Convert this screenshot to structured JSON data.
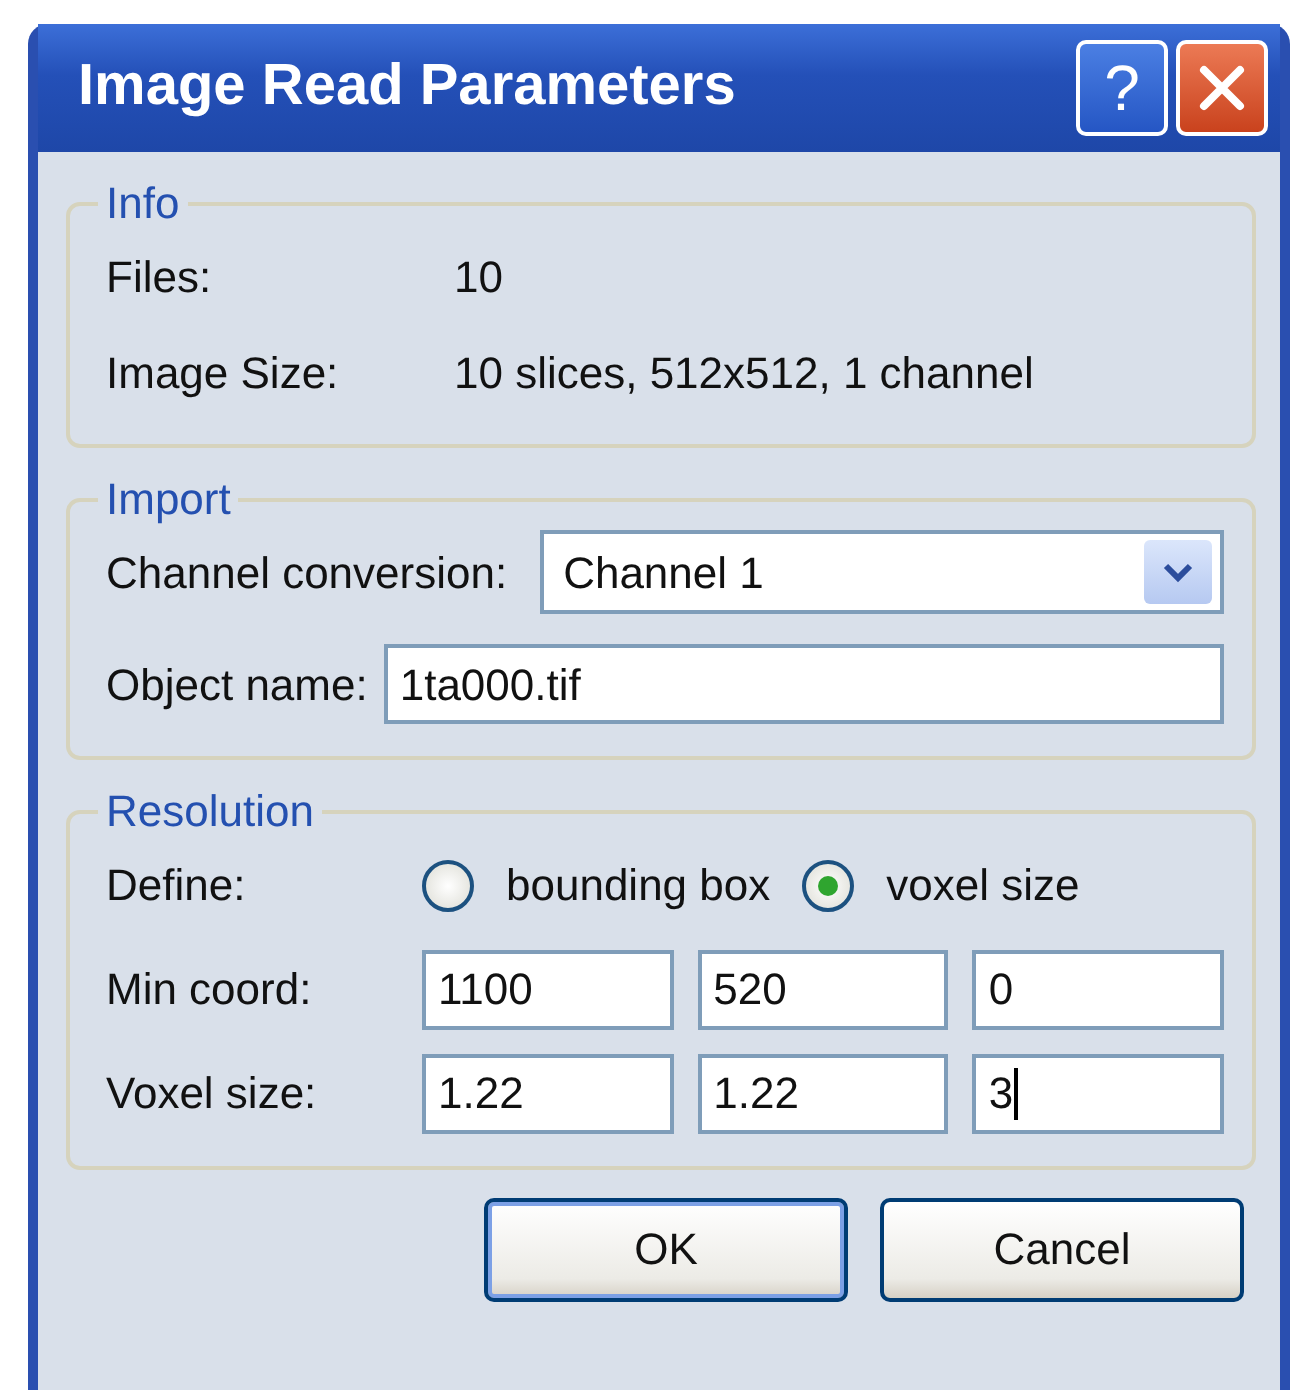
{
  "window": {
    "title": "Image Read Parameters",
    "help_label": "?"
  },
  "info": {
    "title": "Info",
    "rows": [
      {
        "label": "Files:",
        "value": "10"
      },
      {
        "label": "Image Size:",
        "value": "10 slices, 512x512, 1 channel"
      }
    ]
  },
  "import": {
    "title": "Import",
    "channel_conversion": {
      "label": "Channel conversion:",
      "value": "Channel 1"
    },
    "object_name": {
      "label": "Object name:",
      "value": "1ta000.tif"
    }
  },
  "resolution": {
    "title": "Resolution",
    "define": {
      "label": "Define:",
      "options": [
        {
          "label": "bounding box",
          "selected": false
        },
        {
          "label": "voxel size",
          "selected": true
        }
      ]
    },
    "rows": [
      {
        "label": "Min coord:",
        "fields": [
          {
            "value": "1100",
            "focused": false
          },
          {
            "value": "520",
            "focused": false
          },
          {
            "value": "0",
            "focused": false
          }
        ]
      },
      {
        "label": "Voxel size:",
        "fields": [
          {
            "value": "1.22",
            "focused": false
          },
          {
            "value": "1.22",
            "focused": false
          },
          {
            "value": "3",
            "focused": true
          }
        ]
      }
    ]
  },
  "buttons": [
    {
      "label": "OK",
      "default": true
    },
    {
      "label": "Cancel",
      "default": false
    }
  ]
}
